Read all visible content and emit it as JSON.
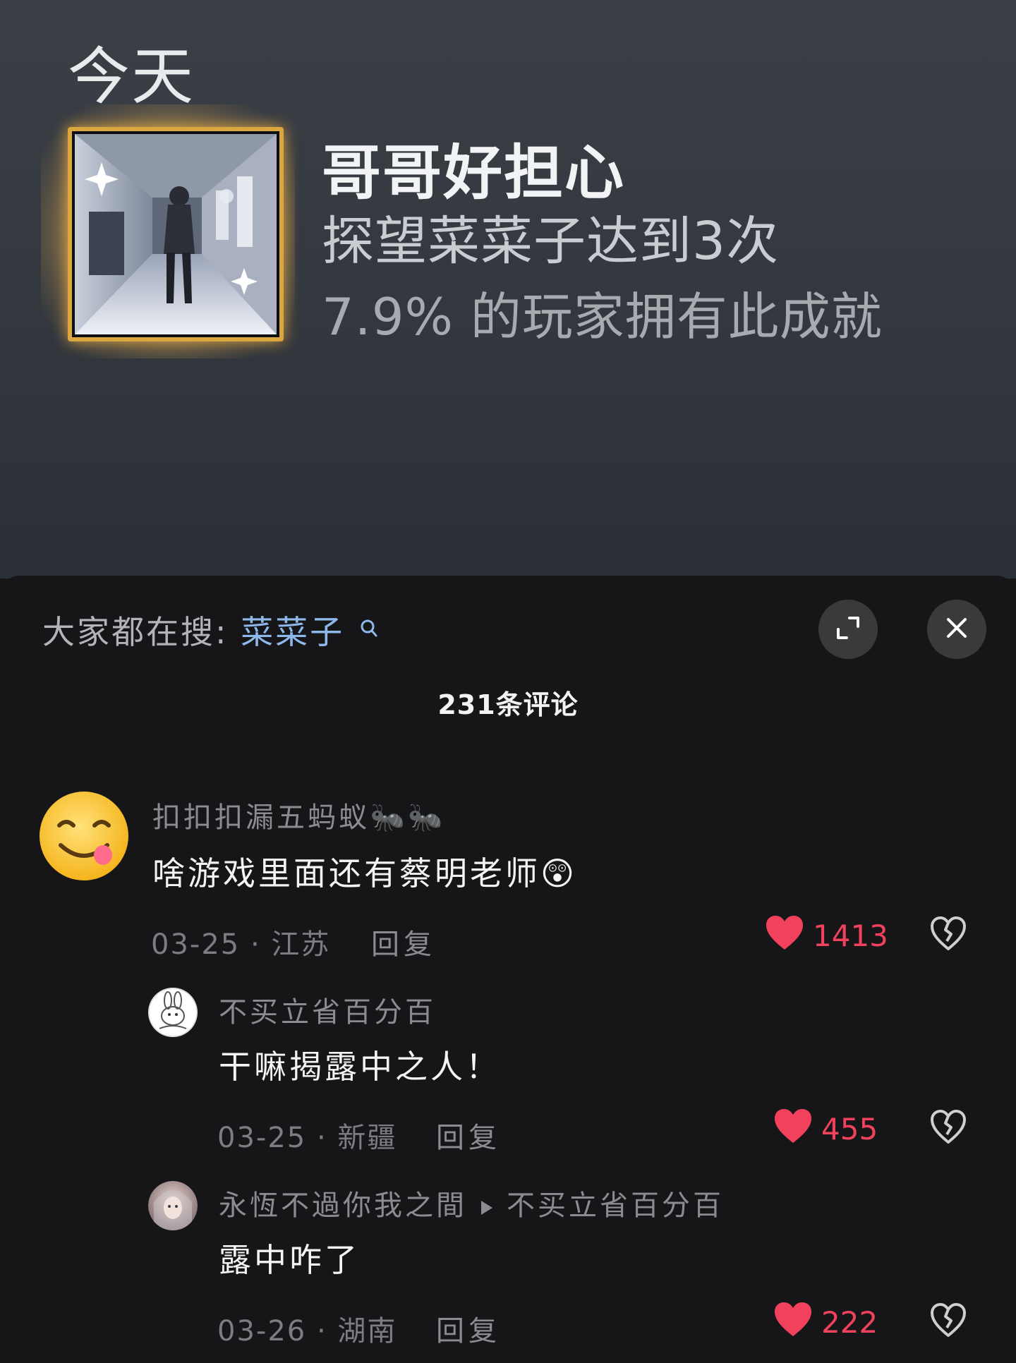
{
  "achievement": {
    "day_label": "今天",
    "title": "哥哥好担心",
    "description": "探望菜菜子达到3次",
    "percent_text": "7.9% 的玩家拥有此成就"
  },
  "sheet": {
    "search_prefix": "大家都在搜:",
    "search_term": "菜菜子",
    "comment_count": "231条评论"
  },
  "comments": [
    {
      "user": "扣扣扣漏五蚂蚁🐜🐜",
      "text": "啥游戏里面还有蔡明老师😲",
      "date": "03-25",
      "region": "江苏",
      "reply_label": "回复",
      "likes": "1413"
    },
    {
      "user": "不买立省百分百",
      "text": "干嘛揭露中之人！",
      "date": "03-25",
      "region": "新疆",
      "reply_label": "回复",
      "likes": "455"
    },
    {
      "user": "永恆不過你我之間",
      "reply_to": "不买立省百分百",
      "text": "露中咋了",
      "date": "03-26",
      "region": "湖南",
      "reply_label": "回复",
      "likes": "222"
    }
  ],
  "colors": {
    "search_term": "#8fb8ea",
    "like": "#f2415c",
    "badge_border": "#d9a640"
  },
  "icons": [
    "expand-icon",
    "close-icon",
    "search-icon",
    "heart-icon",
    "broken-heart-icon",
    "reply-arrow-icon"
  ]
}
